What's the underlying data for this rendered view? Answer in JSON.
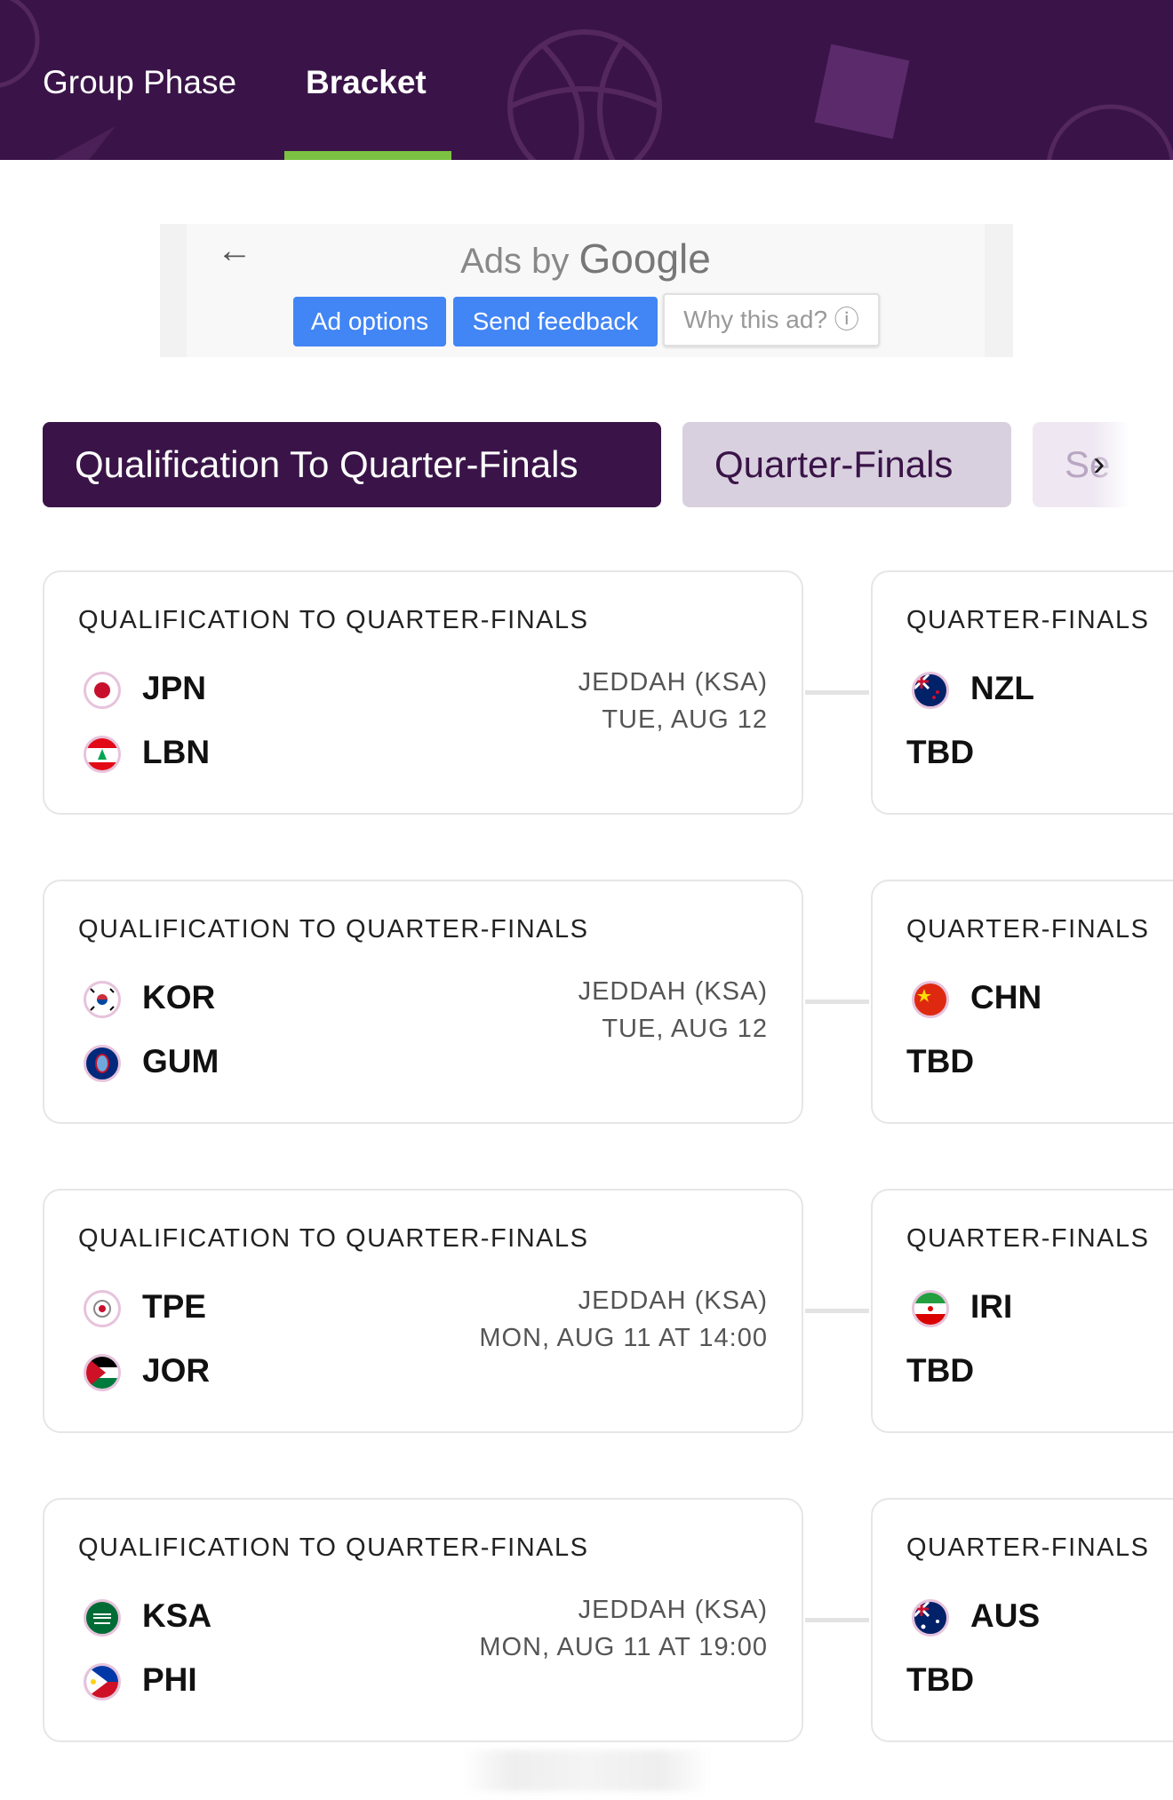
{
  "header": {
    "tabs": [
      {
        "label": "Group Phase",
        "active": false
      },
      {
        "label": "Bracket",
        "active": true
      }
    ],
    "background_color": "#3a1448",
    "active_underline_color": "#7cc242"
  },
  "ad": {
    "title_prefix": "Ads by",
    "title_brand": "Google",
    "back_icon": "arrow-left-icon",
    "buttons": {
      "ad_options": "Ad options",
      "send_feedback": "Send feedback",
      "why_this_ad": "Why this ad? ⓘ"
    }
  },
  "rounds": {
    "items": [
      {
        "label": "Qualification To Quarter-Finals",
        "active": true
      },
      {
        "label": "Quarter-Finals",
        "active": false
      },
      {
        "label": "Se",
        "active": false
      }
    ],
    "scroll_icon": "chevron-right-icon"
  },
  "matches": [
    {
      "round_label": "QUALIFICATION TO QUARTER-FINALS",
      "team1": {
        "code": "JPN",
        "flag": "japan-flag-icon"
      },
      "team2": {
        "code": "LBN",
        "flag": "lebanon-flag-icon"
      },
      "venue": "JEDDAH (KSA)",
      "date": "TUE, AUG 12",
      "next": {
        "round_label": "QUARTER-FINALS",
        "team": {
          "code": "NZL",
          "flag": "new-zealand-flag-icon"
        },
        "opponent": "TBD"
      }
    },
    {
      "round_label": "QUALIFICATION TO QUARTER-FINALS",
      "team1": {
        "code": "KOR",
        "flag": "korea-flag-icon"
      },
      "team2": {
        "code": "GUM",
        "flag": "guam-flag-icon"
      },
      "venue": "JEDDAH (KSA)",
      "date": "TUE, AUG 12",
      "next": {
        "round_label": "QUARTER-FINALS",
        "team": {
          "code": "CHN",
          "flag": "china-flag-icon"
        },
        "opponent": "TBD"
      }
    },
    {
      "round_label": "QUALIFICATION TO QUARTER-FINALS",
      "team1": {
        "code": "TPE",
        "flag": "chinese-taipei-flag-icon"
      },
      "team2": {
        "code": "JOR",
        "flag": "jordan-flag-icon"
      },
      "venue": "JEDDAH (KSA)",
      "date": "MON, AUG 11 AT 14:00",
      "next": {
        "round_label": "QUARTER-FINALS",
        "team": {
          "code": "IRI",
          "flag": "iran-flag-icon"
        },
        "opponent": "TBD"
      }
    },
    {
      "round_label": "QUALIFICATION TO QUARTER-FINALS",
      "team1": {
        "code": "KSA",
        "flag": "saudi-arabia-flag-icon"
      },
      "team2": {
        "code": "PHI",
        "flag": "philippines-flag-icon"
      },
      "venue": "JEDDAH (KSA)",
      "date": "MON, AUG 11 AT 19:00",
      "next": {
        "round_label": "QUARTER-FINALS",
        "team": {
          "code": "AUS",
          "flag": "australia-flag-icon"
        },
        "opponent": "TBD"
      }
    }
  ]
}
